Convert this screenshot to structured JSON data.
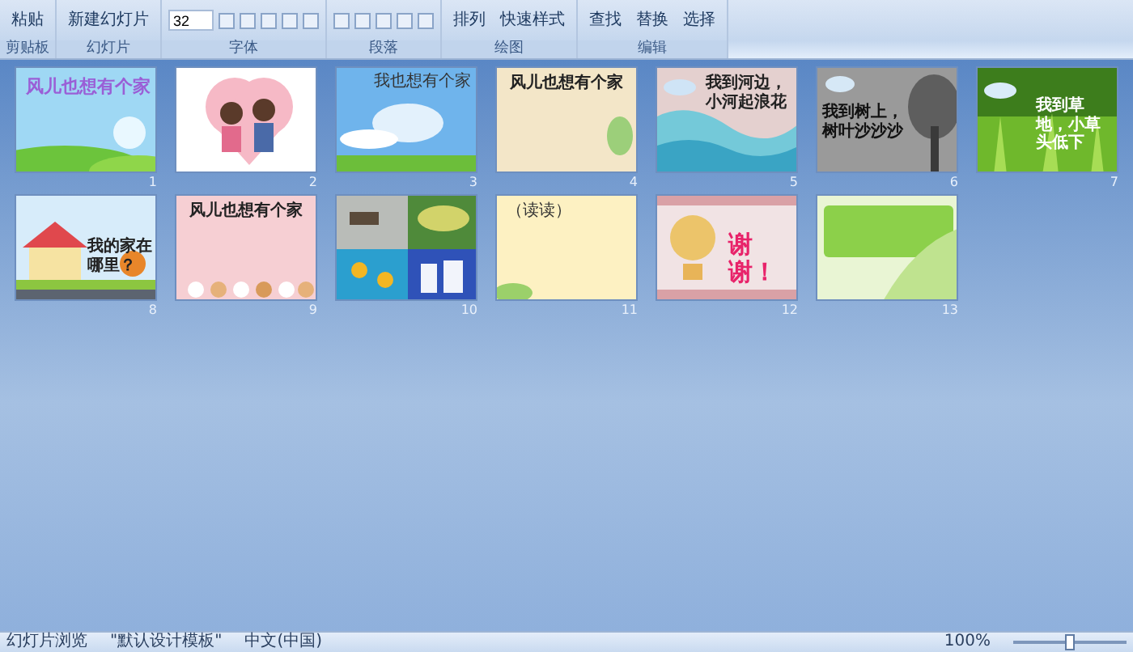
{
  "ribbon": {
    "groups": [
      {
        "label": "剪贴板",
        "buttons": [
          "粘贴"
        ]
      },
      {
        "label": "幻灯片",
        "buttons": [
          "新建幻灯片"
        ]
      },
      {
        "label": "字体",
        "font_size": "32"
      },
      {
        "label": "段落"
      },
      {
        "label": "绘图",
        "buttons": [
          "排列",
          "快速样式"
        ]
      },
      {
        "label": "编辑",
        "buttons": [
          "查找",
          "替换",
          "选择"
        ]
      }
    ]
  },
  "slides": [
    {
      "number": "1",
      "kind": "sky",
      "title": "风儿也想有个家",
      "selected": false
    },
    {
      "number": "2",
      "kind": "hearts",
      "selected": false
    },
    {
      "number": "3",
      "kind": "cloud",
      "title": "我也想有个家",
      "selected": false
    },
    {
      "number": "4",
      "kind": "paper",
      "title": "风儿也想有个家",
      "selected": false
    },
    {
      "number": "5",
      "kind": "waves",
      "title": "我到河边，小河起浪花",
      "selected": false
    },
    {
      "number": "6",
      "kind": "tree",
      "title": "我到树上，树叶沙沙沙",
      "selected": false
    },
    {
      "number": "7",
      "kind": "grass",
      "title": "我到草地，小草头低下",
      "selected": false
    },
    {
      "number": "8",
      "kind": "house",
      "title": "我的家在哪里？",
      "selected": false
    },
    {
      "number": "9",
      "kind": "pink",
      "title": "风儿也想有个家",
      "selected": false
    },
    {
      "number": "10",
      "kind": "photos",
      "selected": false
    },
    {
      "number": "11",
      "kind": "yellow",
      "title": "（读读）",
      "selected": false
    },
    {
      "number": "12",
      "kind": "bear",
      "title": "谢谢！",
      "selected": false
    },
    {
      "number": "13",
      "kind": "green",
      "selected": false
    }
  ],
  "status_bar": {
    "view": "幻灯片浏览",
    "theme": "\"默认设计模板\"",
    "language": "中文(中国)",
    "zoom": "100%",
    "level": 0.5
  }
}
